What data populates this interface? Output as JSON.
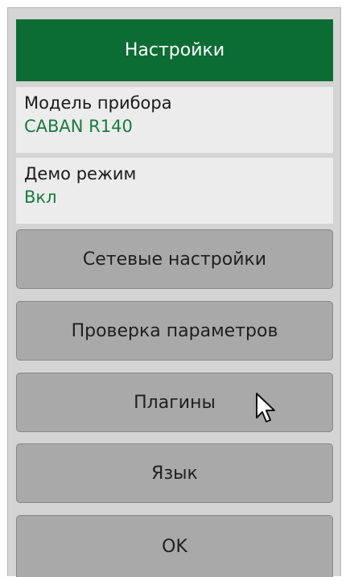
{
  "header": {
    "title": "Настройки"
  },
  "info": {
    "model_label": "Модель прибора",
    "model_value": "CABAN R140",
    "demo_label": "Демо режим",
    "demo_value": "Вкл"
  },
  "buttons": {
    "network": "Сетевые настройки",
    "check": "Проверка параметров",
    "plugins": "Плагины",
    "language": "Язык",
    "ok": "OK"
  },
  "colors": {
    "header_bg": "#0c6d34",
    "value_text": "#197b3f",
    "button_bg": "#a9a9a9",
    "panel_bg": "#d4d4d4"
  },
  "icons": {
    "cursor": "mouse-pointer-icon"
  }
}
